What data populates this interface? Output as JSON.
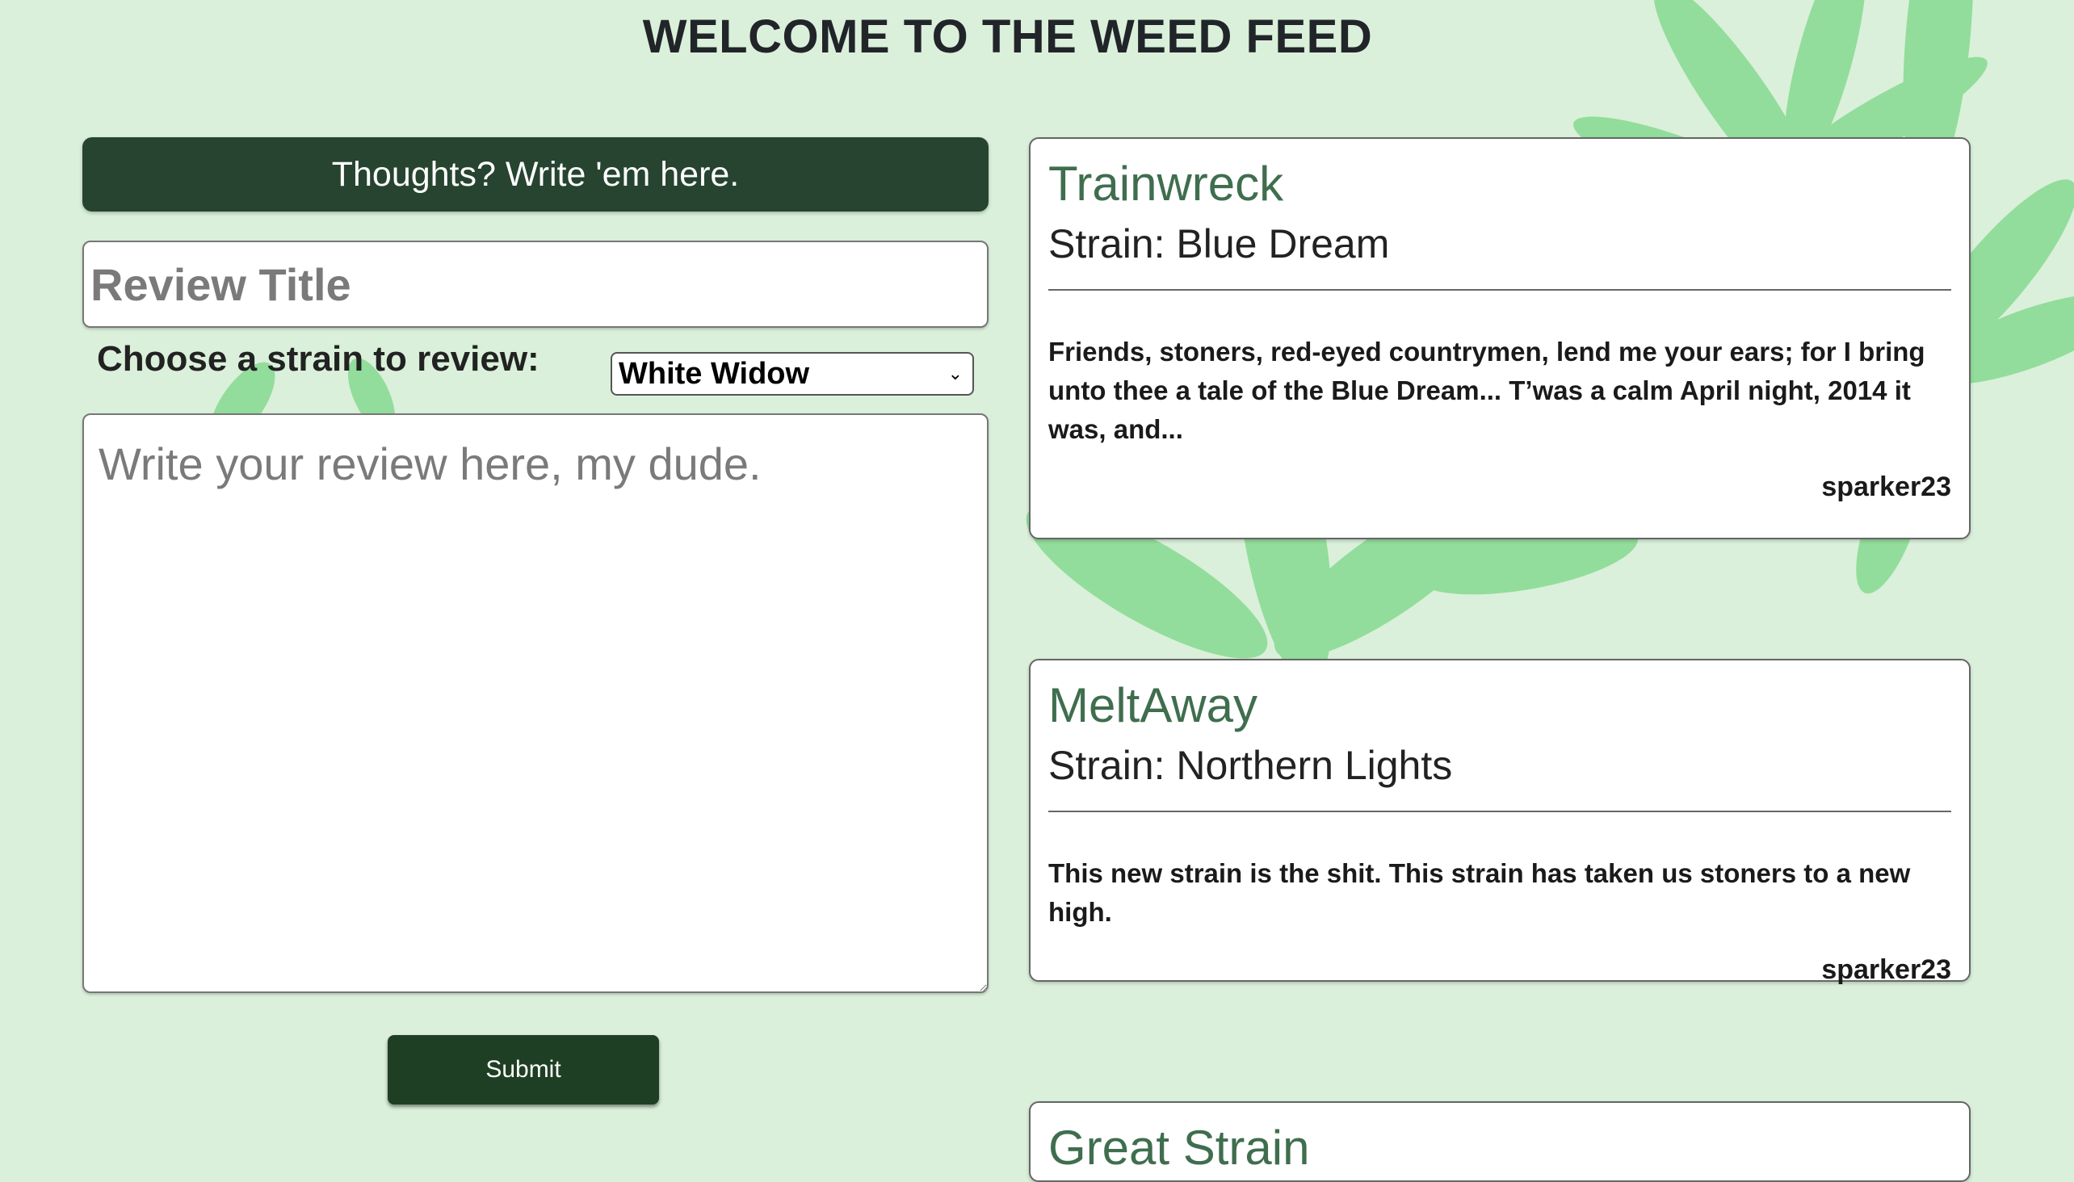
{
  "page": {
    "title": "WELCOME TO THE WEED FEED",
    "background_color": "#daf0da",
    "accent_color": "#264430",
    "background_decoration": "cannabis-leaf-icon"
  },
  "form": {
    "header": "Thoughts? Write 'em here.",
    "title_placeholder": "Review Title",
    "strain_label": "Choose a strain to review:",
    "selected_strain": "White Widow",
    "review_placeholder": "Write your review here, my dude.",
    "submit_label": "Submit"
  },
  "reviews": [
    {
      "title": "Trainwreck",
      "strain": "Strain: Blue Dream",
      "body": "Friends, stoners, red-eyed countrymen, lend me your ears; for I bring unto thee a tale of the Blue Dream... T’was a calm April night, 2014 it was, and...",
      "author": "sparker23"
    },
    {
      "title": "MeltAway",
      "strain": "Strain: Northern Lights",
      "body": "This new strain is the shit. This strain has taken us stoners to a new high.",
      "author": "sparker23"
    },
    {
      "title": "Great Strain"
    }
  ]
}
